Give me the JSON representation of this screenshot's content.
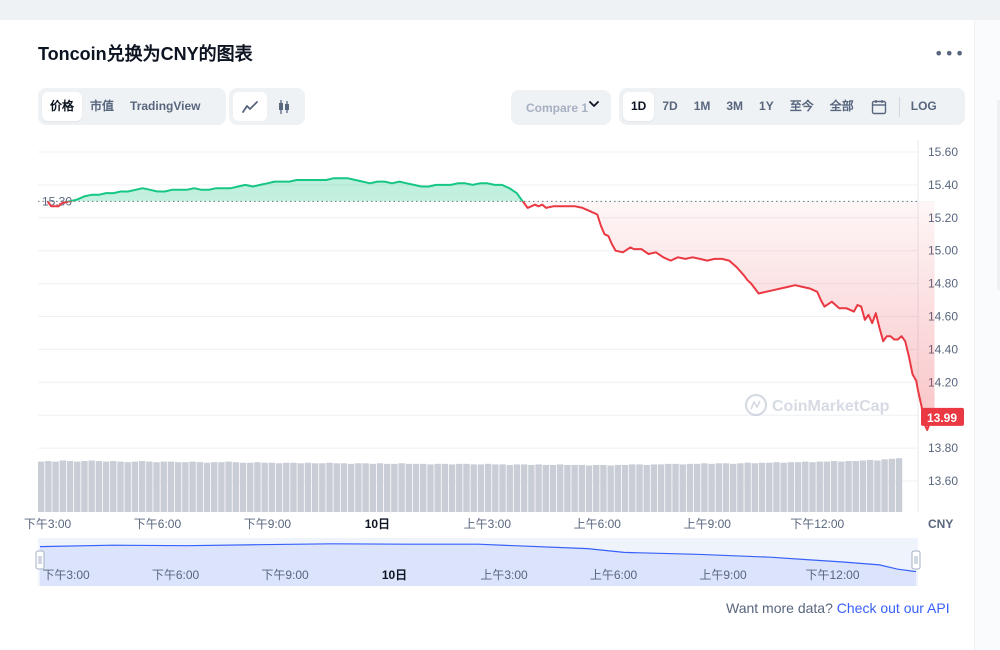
{
  "title": "Toncoin兑换为CNY的图表",
  "more_icon": "more-horizontal-icon",
  "type_tabs": [
    {
      "label": "价格",
      "active": true
    },
    {
      "label": "市值",
      "active": false
    },
    {
      "label": "TradingView",
      "active": false
    }
  ],
  "view_icons": [
    "line-chart-icon",
    "candlestick-icon"
  ],
  "compare": {
    "label": "Compare 1"
  },
  "time_tabs": [
    {
      "label": "1D",
      "active": true
    },
    {
      "label": "7D",
      "active": false
    },
    {
      "label": "1M",
      "active": false
    },
    {
      "label": "3M",
      "active": false
    },
    {
      "label": "1Y",
      "active": false
    },
    {
      "label": "至今",
      "active": false
    },
    {
      "label": "全部",
      "active": false
    }
  ],
  "calendar_icon": "calendar-icon",
  "log_label": "LOG",
  "watermark": "CoinMarketCap",
  "footer": {
    "text": "Want more data? ",
    "link": "Check out our API"
  },
  "chart_data": {
    "type": "line",
    "currency_label": "CNY",
    "ylim": [
      13.5,
      15.7
    ],
    "y_ticks": [
      "15.60",
      "15.40",
      "15.20",
      "15.00",
      "14.80",
      "14.60",
      "14.40",
      "14.20",
      "14.00",
      "13.80",
      "13.60"
    ],
    "x_ticks": [
      {
        "label": "下午3:00",
        "x": 0
      },
      {
        "label": "下午6:00",
        "x": 3
      },
      {
        "label": "下午9:00",
        "x": 6
      },
      {
        "label": "10日",
        "x": 9
      },
      {
        "label": "上午3:00",
        "x": 12
      },
      {
        "label": "上午6:00",
        "x": 15
      },
      {
        "label": "上午9:00",
        "x": 18
      },
      {
        "label": "下午12:00",
        "x": 21
      }
    ],
    "x_range": [
      -0.15,
      23.75
    ],
    "baseline": {
      "value": 15.3,
      "label": "15.30"
    },
    "current": {
      "value": 13.99,
      "label": "13.99"
    },
    "grid": true,
    "series": [
      {
        "points": [
          [
            0.0,
            15.3
          ],
          [
            0.1,
            15.27
          ],
          [
            0.3,
            15.27
          ],
          [
            0.4,
            15.29
          ],
          [
            0.6,
            15.3
          ],
          [
            0.8,
            15.31
          ],
          [
            1.0,
            15.33
          ],
          [
            1.2,
            15.34
          ],
          [
            1.4,
            15.34
          ],
          [
            1.6,
            15.35
          ],
          [
            1.8,
            15.35
          ],
          [
            2.0,
            15.36
          ],
          [
            2.2,
            15.36
          ],
          [
            2.4,
            15.37
          ],
          [
            2.6,
            15.38
          ],
          [
            2.8,
            15.37
          ],
          [
            3.0,
            15.36
          ],
          [
            3.2,
            15.36
          ],
          [
            3.4,
            15.37
          ],
          [
            3.6,
            15.37
          ],
          [
            3.8,
            15.37
          ],
          [
            4.0,
            15.38
          ],
          [
            4.2,
            15.37
          ],
          [
            4.4,
            15.37
          ],
          [
            4.6,
            15.38
          ],
          [
            4.8,
            15.38
          ],
          [
            5.0,
            15.38
          ],
          [
            5.2,
            15.39
          ],
          [
            5.4,
            15.4
          ],
          [
            5.6,
            15.39
          ],
          [
            5.8,
            15.4
          ],
          [
            6.0,
            15.41
          ],
          [
            6.2,
            15.42
          ],
          [
            6.4,
            15.42
          ],
          [
            6.6,
            15.42
          ],
          [
            6.8,
            15.43
          ],
          [
            7.0,
            15.43
          ],
          [
            7.2,
            15.43
          ],
          [
            7.4,
            15.43
          ],
          [
            7.6,
            15.43
          ],
          [
            7.8,
            15.44
          ],
          [
            8.0,
            15.44
          ],
          [
            8.2,
            15.44
          ],
          [
            8.4,
            15.43
          ],
          [
            8.6,
            15.42
          ],
          [
            8.8,
            15.41
          ],
          [
            9.0,
            15.42
          ],
          [
            9.2,
            15.42
          ],
          [
            9.4,
            15.41
          ],
          [
            9.6,
            15.42
          ],
          [
            9.8,
            15.41
          ],
          [
            10.0,
            15.4
          ],
          [
            10.2,
            15.39
          ],
          [
            10.4,
            15.39
          ],
          [
            10.6,
            15.4
          ],
          [
            10.8,
            15.4
          ],
          [
            11.0,
            15.4
          ],
          [
            11.2,
            15.41
          ],
          [
            11.4,
            15.41
          ],
          [
            11.6,
            15.4
          ],
          [
            11.8,
            15.41
          ],
          [
            12.0,
            15.41
          ],
          [
            12.2,
            15.4
          ],
          [
            12.4,
            15.4
          ],
          [
            12.6,
            15.38
          ],
          [
            12.8,
            15.35
          ],
          [
            12.9,
            15.32
          ],
          [
            13.0,
            15.29
          ],
          [
            13.1,
            15.26
          ],
          [
            13.2,
            15.27
          ],
          [
            13.3,
            15.28
          ],
          [
            13.4,
            15.27
          ],
          [
            13.5,
            15.28
          ],
          [
            13.6,
            15.26
          ],
          [
            13.8,
            15.27
          ],
          [
            14.0,
            15.27
          ],
          [
            14.2,
            15.27
          ],
          [
            14.4,
            15.27
          ],
          [
            14.6,
            15.26
          ],
          [
            14.8,
            15.24
          ],
          [
            15.0,
            15.22
          ],
          [
            15.1,
            15.15
          ],
          [
            15.2,
            15.1
          ],
          [
            15.3,
            15.09
          ],
          [
            15.4,
            15.04
          ],
          [
            15.5,
            15.0
          ],
          [
            15.7,
            14.99
          ],
          [
            15.9,
            15.02
          ],
          [
            16.0,
            15.01
          ],
          [
            16.2,
            15.01
          ],
          [
            16.4,
            14.98
          ],
          [
            16.6,
            14.99
          ],
          [
            16.8,
            14.96
          ],
          [
            17.0,
            14.94
          ],
          [
            17.2,
            14.96
          ],
          [
            17.4,
            14.95
          ],
          [
            17.6,
            14.96
          ],
          [
            17.8,
            14.95
          ],
          [
            18.0,
            14.94
          ],
          [
            18.2,
            14.95
          ],
          [
            18.4,
            14.95
          ],
          [
            18.6,
            14.94
          ],
          [
            18.8,
            14.9
          ],
          [
            19.0,
            14.85
          ],
          [
            19.1,
            14.82
          ],
          [
            19.2,
            14.8
          ],
          [
            19.3,
            14.77
          ],
          [
            19.4,
            14.74
          ],
          [
            19.6,
            14.75
          ],
          [
            19.8,
            14.76
          ],
          [
            20.0,
            14.77
          ],
          [
            20.2,
            14.78
          ],
          [
            20.4,
            14.79
          ],
          [
            20.6,
            14.78
          ],
          [
            20.8,
            14.77
          ],
          [
            21.0,
            14.75
          ],
          [
            21.1,
            14.7
          ],
          [
            21.2,
            14.66
          ],
          [
            21.4,
            14.69
          ],
          [
            21.6,
            14.65
          ],
          [
            21.8,
            14.65
          ],
          [
            22.0,
            14.63
          ],
          [
            22.1,
            14.67
          ],
          [
            22.2,
            14.66
          ],
          [
            22.3,
            14.58
          ],
          [
            22.4,
            14.61
          ],
          [
            22.5,
            14.56
          ],
          [
            22.6,
            14.62
          ],
          [
            22.7,
            14.53
          ],
          [
            22.8,
            14.45
          ],
          [
            22.9,
            14.48
          ],
          [
            23.0,
            14.48
          ],
          [
            23.1,
            14.46
          ],
          [
            23.2,
            14.46
          ],
          [
            23.3,
            14.48
          ],
          [
            23.4,
            14.45
          ],
          [
            23.5,
            14.36
          ],
          [
            23.6,
            14.25
          ],
          [
            23.7,
            14.21
          ],
          [
            23.75,
            14.15
          ],
          [
            23.85,
            14.05
          ],
          [
            23.9,
            13.96
          ],
          [
            24.0,
            13.91
          ],
          [
            24.1,
            13.97
          ],
          [
            24.2,
            13.99
          ]
        ],
        "up_color": "#16c784",
        "down_color": "#ea3943"
      }
    ],
    "volume_bars": [
      0.9,
      0.91,
      0.9,
      0.92,
      0.91,
      0.9,
      0.91,
      0.92,
      0.91,
      0.9,
      0.91,
      0.9,
      0.89,
      0.9,
      0.91,
      0.9,
      0.89,
      0.9,
      0.9,
      0.89,
      0.89,
      0.9,
      0.89,
      0.88,
      0.89,
      0.89,
      0.9,
      0.89,
      0.88,
      0.88,
      0.89,
      0.88,
      0.88,
      0.87,
      0.88,
      0.88,
      0.87,
      0.88,
      0.87,
      0.87,
      0.88,
      0.87,
      0.87,
      0.86,
      0.87,
      0.87,
      0.86,
      0.87,
      0.86,
      0.86,
      0.87,
      0.86,
      0.86,
      0.86,
      0.85,
      0.86,
      0.86,
      0.85,
      0.86,
      0.86,
      0.85,
      0.85,
      0.86,
      0.85,
      0.85,
      0.84,
      0.85,
      0.85,
      0.84,
      0.85,
      0.84,
      0.84,
      0.85,
      0.84,
      0.84,
      0.84,
      0.83,
      0.84,
      0.84,
      0.83,
      0.84,
      0.84,
      0.85,
      0.85,
      0.84,
      0.85,
      0.85,
      0.86,
      0.86,
      0.85,
      0.86,
      0.86,
      0.87,
      0.86,
      0.87,
      0.87,
      0.86,
      0.87,
      0.88,
      0.87,
      0.88,
      0.88,
      0.89,
      0.88,
      0.89,
      0.89,
      0.9,
      0.89,
      0.9,
      0.9,
      0.91,
      0.9,
      0.91,
      0.91,
      0.92,
      0.93,
      0.92,
      0.94,
      0.95,
      0.96
    ],
    "navigator": {
      "points": [
        [
          0,
          0.82
        ],
        [
          2,
          0.85
        ],
        [
          4,
          0.84
        ],
        [
          6,
          0.86
        ],
        [
          8,
          0.88
        ],
        [
          10,
          0.87
        ],
        [
          12,
          0.87
        ],
        [
          13,
          0.84
        ],
        [
          15,
          0.78
        ],
        [
          16,
          0.7
        ],
        [
          18,
          0.66
        ],
        [
          20,
          0.6
        ],
        [
          21,
          0.55
        ],
        [
          22,
          0.5
        ],
        [
          23,
          0.44
        ],
        [
          23.5,
          0.35
        ],
        [
          24,
          0.3
        ]
      ],
      "x_ticks": [
        {
          "label": "下午3:00",
          "x": 0
        },
        {
          "label": "下午6:00",
          "x": 3
        },
        {
          "label": "下午9:00",
          "x": 6
        },
        {
          "label": "10日",
          "x": 9
        },
        {
          "label": "上午3:00",
          "x": 12
        },
        {
          "label": "上午6:00",
          "x": 15
        },
        {
          "label": "上午9:00",
          "x": 18
        },
        {
          "label": "下午12:00",
          "x": 21
        }
      ]
    }
  }
}
